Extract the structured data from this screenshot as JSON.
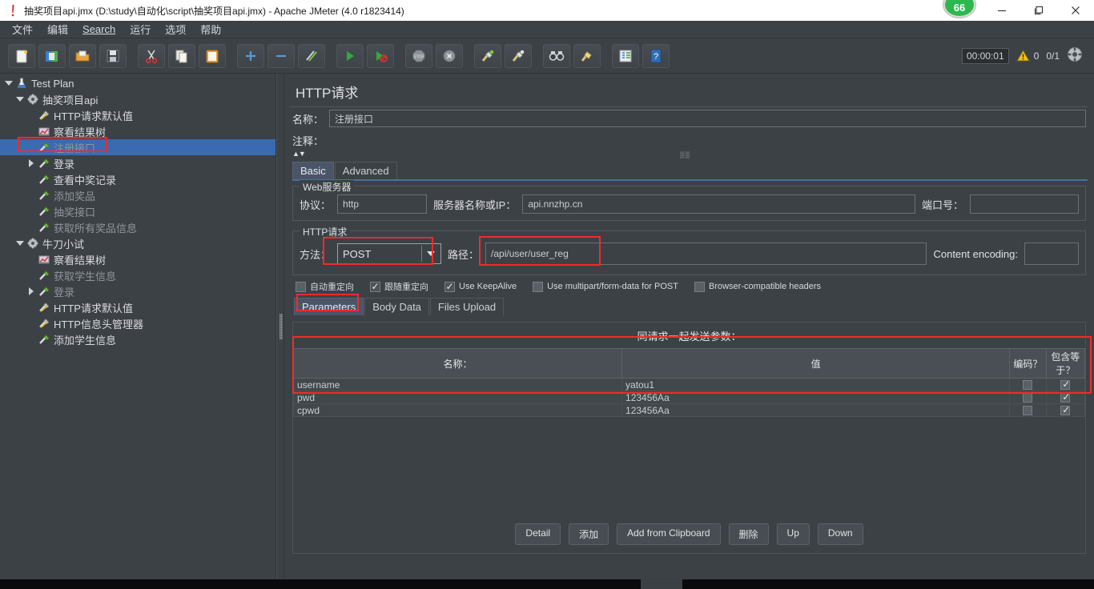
{
  "window": {
    "title": "抽奖项目api.jmx (D:\\study\\自动化\\script\\抽奖项目api.jmx) - Apache JMeter (4.0 r1823414)",
    "app_icon": "jmeter-feather-icon",
    "notification_badge": "66",
    "minimize_label": "—",
    "maximize_label": "❐",
    "close_label": "✕"
  },
  "menubar": {
    "items": [
      {
        "label": "文件",
        "name": "menu-file"
      },
      {
        "label": "编辑",
        "name": "menu-edit"
      },
      {
        "label": "Search",
        "name": "menu-search",
        "mnemonic": "S"
      },
      {
        "label": "运行",
        "name": "menu-run"
      },
      {
        "label": "选项",
        "name": "menu-options"
      },
      {
        "label": "帮助",
        "name": "menu-help"
      }
    ]
  },
  "toolbar": {
    "buttons": [
      {
        "name": "new-icon",
        "title": "New"
      },
      {
        "name": "templates-icon",
        "title": "Templates"
      },
      {
        "name": "open-icon",
        "title": "Open"
      },
      {
        "name": "save-icon",
        "title": "Save"
      },
      {
        "name": "cut-icon",
        "title": "Cut"
      },
      {
        "name": "copy-icon",
        "title": "Copy"
      },
      {
        "name": "paste-icon",
        "title": "Paste"
      },
      {
        "name": "expand-all-icon",
        "title": "Expand"
      },
      {
        "name": "collapse-all-icon",
        "title": "Collapse"
      },
      {
        "name": "toggle-icon",
        "title": "Toggle"
      },
      {
        "name": "start-icon",
        "title": "Start"
      },
      {
        "name": "start-no-pauses-icon",
        "title": "Start no pauses"
      },
      {
        "name": "stop-icon",
        "title": "Stop"
      },
      {
        "name": "shutdown-icon",
        "title": "Shutdown"
      },
      {
        "name": "clear-icon",
        "title": "Clear"
      },
      {
        "name": "clear-all-icon",
        "title": "Clear All"
      },
      {
        "name": "search-icon",
        "title": "Search"
      },
      {
        "name": "search-reset-icon",
        "title": "Reset Search"
      },
      {
        "name": "function-helper-icon",
        "title": "Function Helper"
      },
      {
        "name": "help-icon",
        "title": "Help"
      }
    ],
    "timer": "00:00:01",
    "warning_count": "0",
    "threads": "0/1",
    "status_icon": "remote-engines-icon"
  },
  "tree": {
    "items": [
      {
        "label": "Test Plan",
        "indent": 0,
        "twist": "down",
        "icon": "test-plan-icon",
        "dim": false,
        "selected": false
      },
      {
        "label": "抽奖项目api",
        "indent": 1,
        "twist": "down",
        "icon": "thread-group-icon",
        "dim": false,
        "selected": false
      },
      {
        "label": "HTTP请求默认值",
        "indent": 2,
        "twist": "none",
        "icon": "config-icon",
        "dim": false,
        "selected": false
      },
      {
        "label": "察看结果树",
        "indent": 2,
        "twist": "none",
        "icon": "view-results-icon",
        "dim": false,
        "selected": false
      },
      {
        "label": "注册接口",
        "indent": 2,
        "twist": "none",
        "icon": "http-sampler-icon",
        "dim": true,
        "selected": true
      },
      {
        "label": "登录",
        "indent": 2,
        "twist": "right",
        "icon": "http-sampler-icon",
        "dim": false,
        "selected": false
      },
      {
        "label": "查看中奖记录",
        "indent": 2,
        "twist": "none",
        "icon": "http-sampler-icon",
        "dim": false,
        "selected": false
      },
      {
        "label": "添加奖品",
        "indent": 2,
        "twist": "none",
        "icon": "http-sampler-icon",
        "dim": true,
        "selected": false
      },
      {
        "label": "抽奖接口",
        "indent": 2,
        "twist": "none",
        "icon": "http-sampler-icon",
        "dim": true,
        "selected": false
      },
      {
        "label": "获取所有奖品信息",
        "indent": 2,
        "twist": "none",
        "icon": "http-sampler-icon",
        "dim": true,
        "selected": false
      },
      {
        "label": "牛刀小试",
        "indent": 1,
        "twist": "down",
        "icon": "thread-group-icon",
        "dim": false,
        "selected": false
      },
      {
        "label": "察看结果树",
        "indent": 2,
        "twist": "none",
        "icon": "view-results-icon",
        "dim": false,
        "selected": false
      },
      {
        "label": "获取学生信息",
        "indent": 2,
        "twist": "none",
        "icon": "http-sampler-icon",
        "dim": true,
        "selected": false
      },
      {
        "label": "登录",
        "indent": 2,
        "twist": "right",
        "icon": "http-sampler-icon",
        "dim": true,
        "selected": false
      },
      {
        "label": "HTTP请求默认值",
        "indent": 2,
        "twist": "none",
        "icon": "config-icon",
        "dim": false,
        "selected": false
      },
      {
        "label": "HTTP信息头管理器",
        "indent": 2,
        "twist": "none",
        "icon": "config-icon",
        "dim": false,
        "selected": false
      },
      {
        "label": "添加学生信息",
        "indent": 2,
        "twist": "none",
        "icon": "http-sampler-icon",
        "dim": false,
        "selected": false
      }
    ]
  },
  "main": {
    "panel_title": "HTTP请求",
    "name_label": "名称：",
    "name_value": "注册接口",
    "comment_label": "注释：",
    "comment_value": "",
    "tabs": [
      {
        "label": "Basic",
        "active": true
      },
      {
        "label": "Advanced",
        "active": false
      }
    ],
    "web_server": {
      "group_title": "Web服务器",
      "protocol_label": "协议：",
      "protocol_value": "http",
      "server_label": "服务器名称或IP：",
      "server_value": "api.nnzhp.cn",
      "port_label": "端口号：",
      "port_value": ""
    },
    "http_request": {
      "group_title": "HTTP请求",
      "method_label": "方法：",
      "method_value": "POST",
      "path_label": "路径：",
      "path_value": "/api/user/user_reg",
      "content_encoding_label": "Content encoding:",
      "content_encoding_value": ""
    },
    "options": [
      {
        "label": "自动重定向",
        "checked": false
      },
      {
        "label": "跟随重定向",
        "checked": true
      },
      {
        "label": "Use KeepAlive",
        "checked": true
      },
      {
        "label": "Use multipart/form-data for POST",
        "checked": false
      },
      {
        "label": "Browser-compatible headers",
        "checked": false
      }
    ],
    "param_tabs": [
      {
        "label": "Parameters",
        "active": true
      },
      {
        "label": "Body Data",
        "active": false
      },
      {
        "label": "Files Upload",
        "active": false
      }
    ],
    "params": {
      "caption": "同请求一起发送参数：",
      "columns": [
        "名称：",
        "值",
        "编码？",
        "包含等于？"
      ],
      "rows": [
        {
          "name": "username",
          "value": "yatou1",
          "encode": false,
          "include_equals": true
        },
        {
          "name": "pwd",
          "value": "123456Aa",
          "encode": false,
          "include_equals": true
        },
        {
          "name": "cpwd",
          "value": "123456Aa",
          "encode": false,
          "include_equals": true
        }
      ],
      "buttons": [
        {
          "label": "Detail",
          "name": "detail-button"
        },
        {
          "label": "添加",
          "name": "add-button"
        },
        {
          "label": "Add from Clipboard",
          "name": "add-from-clipboard-button"
        },
        {
          "label": "删除",
          "name": "delete-button"
        },
        {
          "label": "Up",
          "name": "up-button"
        },
        {
          "label": "Down",
          "name": "down-button"
        }
      ]
    }
  },
  "colors": {
    "accent_blue": "#3a6bb0",
    "annotation_red": "#f42a2a",
    "panel_bg": "#3c4146",
    "badge_green": "#2db84d"
  }
}
